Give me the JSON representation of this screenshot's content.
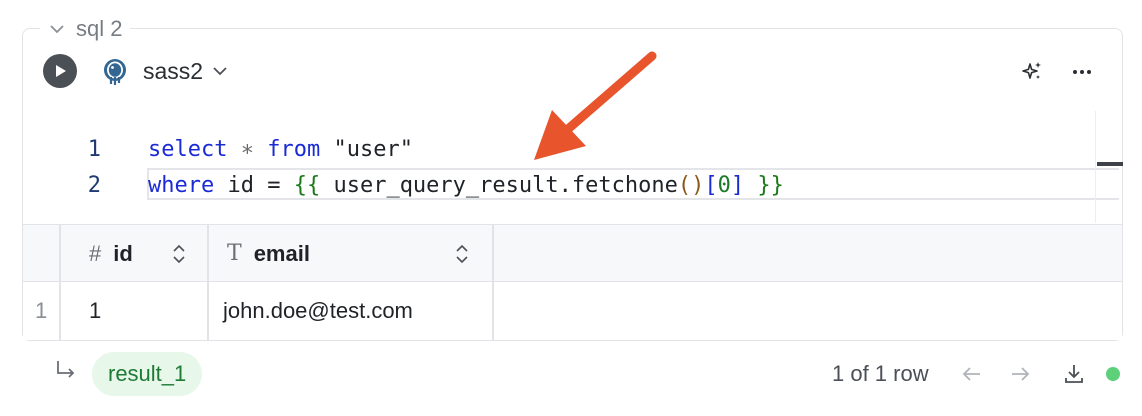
{
  "cell": {
    "title": "sql 2",
    "database_name": "sass2"
  },
  "editor": {
    "lines": [
      {
        "number": "1",
        "tokens": {
          "t1": "select",
          "t2": " ∗ ",
          "t3": "from",
          "t4": " \"user\""
        }
      },
      {
        "number": "2",
        "tokens": {
          "t1": "where",
          "t2": " id = ",
          "t3": "{{",
          "t4": " user_query_result.fetchone",
          "t5": "()",
          "t6": "[",
          "t7": "0",
          "t8": "]",
          "t9": " ",
          "t10": "}}"
        }
      }
    ]
  },
  "results": {
    "columns": [
      {
        "type_icon": "#",
        "name": "id"
      },
      {
        "type_icon": "T",
        "name": "email"
      }
    ],
    "rows": [
      {
        "row_number": "1",
        "id": "1",
        "email": "john.doe@test.com"
      }
    ]
  },
  "footer": {
    "result_name": "result_1",
    "row_count": "1 of 1 row",
    "status_color": "#5dd07a"
  },
  "icons": {
    "run": "play-icon",
    "database": "postgres-elephant-icon",
    "dropdown": "chevron-down-icon",
    "ai": "sparkles-icon",
    "more": "more-dots-icon",
    "sort": "sort-updown-icon",
    "return": "return-arrow-icon",
    "prev": "arrow-left-icon",
    "next": "arrow-right-icon",
    "download": "download-icon"
  },
  "colors": {
    "keyword": "#1a2bd6",
    "template_brace": "#1a7a1a",
    "result_chip_bg": "#e7f7ea",
    "result_chip_text": "#1e7a35"
  }
}
